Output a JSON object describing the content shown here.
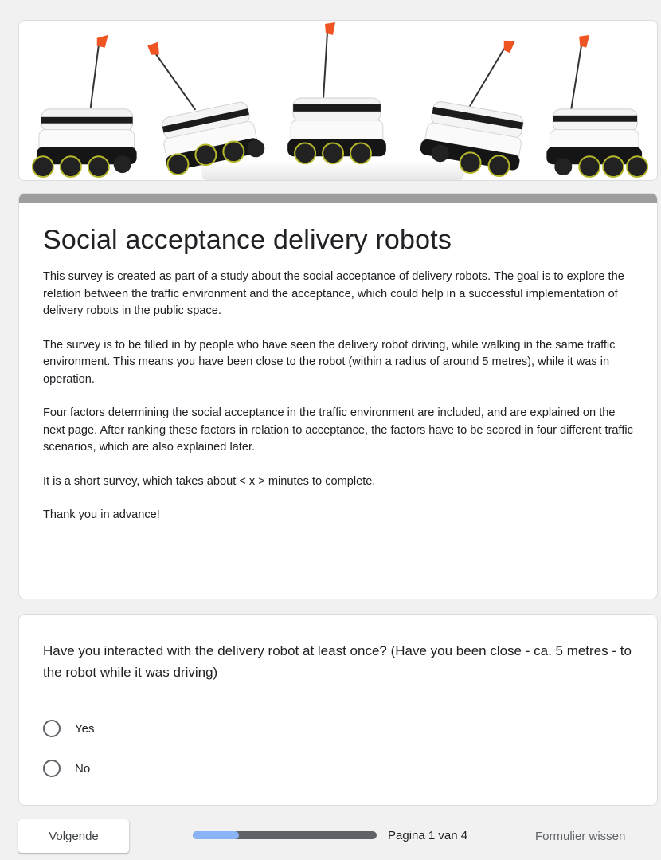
{
  "header": {
    "image_icon": "delivery-robots-banner"
  },
  "form": {
    "title": "Social acceptance delivery robots",
    "accent_color": "#9e9e9e",
    "description": [
      "This survey is created as part of a study about the social acceptance of delivery robots. The goal is to explore the relation between the traffic environment and the acceptance, which could help in a successful implementation of delivery robots in the public space.",
      "The survey is to be filled in by people who have seen the delivery robot driving, while walking in the same traffic environment. This means you have been close to the robot (within a radius of around 5 metres), while it was in operation.",
      "Four factors determining the social acceptance in the traffic environment are included, and are explained on the next page. After ranking these factors in relation to acceptance, the factors have to be scored in four different traffic scenarios, which are also explained later.",
      "It is a short survey, which takes about < x > minutes to complete.",
      "Thank you in advance!"
    ]
  },
  "question": {
    "text": "Have you interacted with the delivery robot at least once? (Have you been close - ca. 5 metres - to the robot while it was driving)",
    "options": [
      {
        "label": "Yes"
      },
      {
        "label": "No"
      }
    ]
  },
  "footer": {
    "next_label": "Volgende",
    "page_indicator": "Pagina 1 van 4",
    "progress_fraction": 0.25,
    "progress_color": "#8ab4f8",
    "clear_label": "Formulier wissen"
  }
}
